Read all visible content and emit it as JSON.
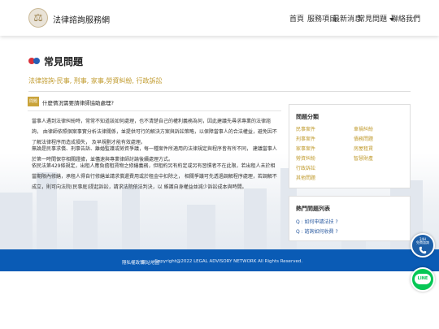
{
  "header": {
    "brand": "法律諮詢服務網",
    "logo_icon": "scales-icon",
    "nav": [
      {
        "label": "首頁"
      },
      {
        "label": "服務項目"
      },
      {
        "label": "最新消息"
      },
      {
        "label": "常見問題",
        "dropdown": true
      },
      {
        "label": "聯絡我們"
      }
    ]
  },
  "main": {
    "title": "常見問題",
    "subtitle": "法律諮詢-民事, 刑事, 家事,勞資糾紛, 行政訴訟",
    "question": {
      "badge": "問題",
      "text": "什麼情況需要請律師協助處理?"
    },
    "paragraphs": [
      "當事人遇到法律糾紛時，常常不知道該如何處理，也不清楚自己的權利義務為何，因此建議先尋求專業的法律諮詢， 由律師依照個案事實分析法律關係，並提供可行的解決方案與訴訟策略，以保障當事人的合法權益，避免因不了解法律程序而造成損失， 及早規劃才能有效處理。",
      "無論是民事求償、刑事告訴、離婚監護或勞資爭議，每一種案件所適用的法律規定與程序皆有所不同， 建議當事人於第一時間保存相關證據，並儘速與專業律師討論後續處理方式。",
      "依民法第429條規定，出租人應負擔租賃物之修繕義務，但租約另有約定或另有習慣者不在此限，若出租人未於相當期限內修繕，承租人得自行修繕並請求償還費用或於租金中扣除之， 相關爭議可先透過調解程序處理，若調解不成立，則可向法院(民事庭)提起訴訟，請求法院依法判決，以 維護自身權益並減少訴訟成本與時間。"
    ]
  },
  "sidebar": {
    "categories_title": "問題分類",
    "categories_left": [
      "民事案件",
      "刑事案件",
      "家事案件",
      "勞資糾紛",
      "行政訴訟",
      "其他問題"
    ],
    "categories_right": [
      "車禍糾紛",
      "債務問題",
      "房屋租賃",
      "智慧財產"
    ],
    "faq_title": "熱門問題列表",
    "faq": [
      "Q : 如何申請法扶 ?",
      "Q : 諮詢如何收費 ?"
    ]
  },
  "footer": {
    "links": [
      "隱私權政策",
      "網站地圖"
    ],
    "copyright": "Copyright@2022 LEGAL ADVISORY NETWORK All Rights Reserved."
  },
  "floating": {
    "phone_label_1": "24H",
    "phone_label_2": "免費諮詢",
    "phone_icon": "phone-icon",
    "line_label": "LINE",
    "line_color": "#06c755",
    "footer_color": "#0a5bb5",
    "accent_color": "#c09a2c"
  }
}
